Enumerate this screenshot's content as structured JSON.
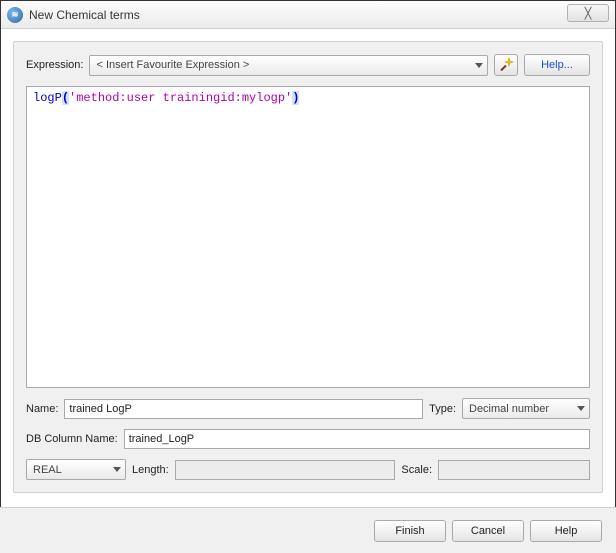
{
  "window": {
    "title": "New Chemical terms",
    "close_glyph": "╳"
  },
  "toolbar": {
    "expression_label": "Expression:",
    "combo_value": "< Insert Favourite Expression >",
    "help_label": "Help..."
  },
  "code": {
    "func": "logP",
    "open_paren": "(",
    "string": "'method:user trainingid:mylogp'",
    "close_paren": ")"
  },
  "fields": {
    "name_label": "Name:",
    "name_value": "trained LogP",
    "type_label": "Type:",
    "type_value": "Decimal number",
    "dbcol_label": "DB Column Name:",
    "dbcol_value": "trained_LogP",
    "datatype_value": "REAL",
    "length_label": "Length:",
    "length_value": "",
    "scale_label": "Scale:",
    "scale_value": ""
  },
  "footer": {
    "finish": "Finish",
    "cancel": "Cancel",
    "help": "Help"
  }
}
